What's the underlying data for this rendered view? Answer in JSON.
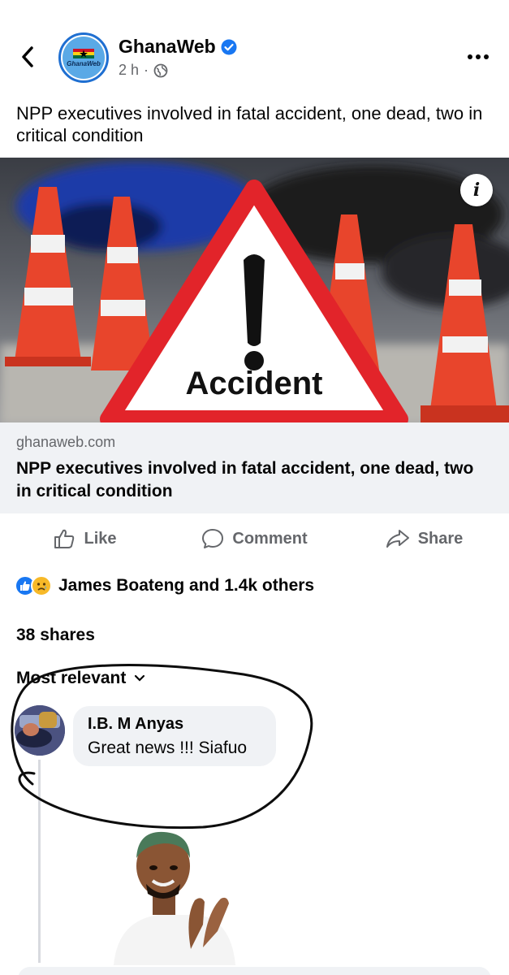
{
  "header": {
    "page_name": "GhanaWeb",
    "avatar_text": "GhanaWeb",
    "time": "2 h",
    "separator": "·"
  },
  "post": {
    "text": "NPP executives involved in fatal accident, one dead, two in critical condition"
  },
  "link_card": {
    "sign_text": "Accident",
    "info_label": "i",
    "domain": "ghanaweb.com",
    "title": "NPP executives involved in fatal accident, one dead, two in critical condition"
  },
  "actions": {
    "like": "Like",
    "comment": "Comment",
    "share": "Share"
  },
  "reactions": {
    "summary": "James Boateng and 1.4k others"
  },
  "shares": {
    "label": "38 shares"
  },
  "comments": {
    "sort_label": "Most relevant",
    "items": [
      {
        "author": "I.B. M Anyas",
        "text": "Great news !!! Siafuo"
      }
    ]
  },
  "colors": {
    "brand_blue": "#1877f2",
    "verified": "#1877f2",
    "muted_text": "#65676b",
    "card_bg": "#f0f2f5",
    "warning_red": "#e2242a"
  },
  "icons": [
    "back-arrow-icon",
    "verified-badge-icon",
    "globe-icon",
    "more-options-icon",
    "info-icon",
    "like-thumb-icon",
    "comment-bubble-icon",
    "share-arrow-icon",
    "like-reaction-icon",
    "sad-reaction-icon",
    "chevron-down-icon"
  ]
}
